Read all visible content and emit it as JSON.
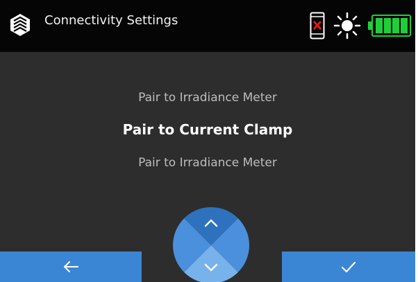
{
  "header": {
    "title": "Connectivity Settings",
    "icons": {
      "logo": "brand-logo-icon",
      "phone": "phone-disconnected-icon",
      "brightness": "sun-brightness-icon",
      "battery": "battery-full-icon"
    }
  },
  "menu": {
    "items": [
      {
        "label": "Pair to Irradiance Meter",
        "state": "inactive"
      },
      {
        "label": "Pair to Current Clamp",
        "state": "selected"
      },
      {
        "label": "Pair to Irradiance Meter",
        "state": "inactive"
      }
    ]
  },
  "softkeys": {
    "left": {
      "icon": "arrow-left-icon"
    },
    "right": {
      "icon": "checkmark-icon"
    }
  },
  "dpad": {
    "up": "chevron-up-icon",
    "down": "chevron-down-icon"
  },
  "battery": {
    "level": 1.0
  },
  "colors": {
    "header_bg": "#050505",
    "screen_bg": "#2d2d2d",
    "accent": "#3a86d4",
    "battery": "#1fcf3a",
    "warning": "#e01919"
  }
}
